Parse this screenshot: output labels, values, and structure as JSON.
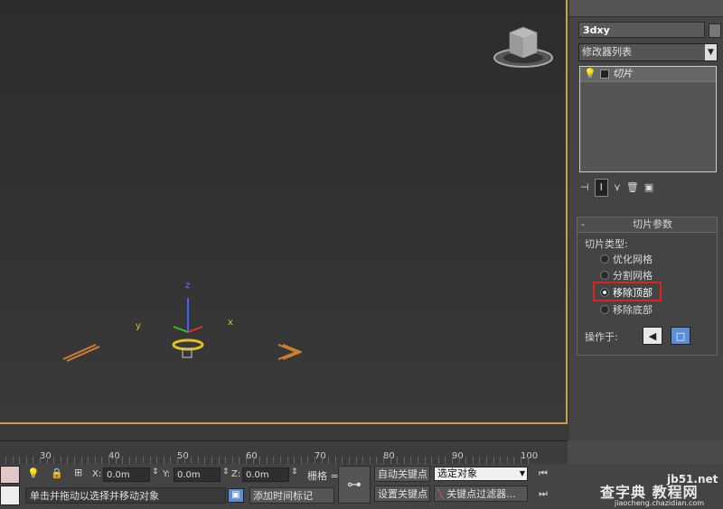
{
  "viewport": {
    "axis_labels": {
      "x": "x",
      "y": "y",
      "z": "z"
    }
  },
  "command_panel": {
    "object_name": "3dxy",
    "modifier_list": "修改器列表",
    "stack_item": "切片",
    "rollout_title": "切片参数",
    "slice_type_label": "切片类型:",
    "options": [
      "优化网格",
      "分割网格",
      "移除顶部",
      "移除底部"
    ],
    "selected_option": "移除顶部",
    "operate_on_label": "操作于:"
  },
  "timeline": {
    "ticks": [
      "30",
      "40",
      "50",
      "60",
      "70",
      "80",
      "90",
      "100"
    ]
  },
  "statusbar": {
    "x_label": "X:",
    "x_value": "0.0m",
    "y_label": "Y:",
    "y_value": "0.0m",
    "z_label": "Z:",
    "z_value": "0.0m",
    "grid_label": "栅格 =",
    "prompt": "单击并拖动以选择并移动对象",
    "add_time_tag": "添加时间标记",
    "auto_key": "自动关键点",
    "set_key": "设置关键点",
    "selected_object": "选定对象",
    "key_filters": "关键点过滤器..."
  },
  "watermark": {
    "site": "jb51.net",
    "text": "查字典 教程网",
    "url": "jiaocheng.chazidian.com"
  },
  "colors": {
    "accent_border": "#c9a14a",
    "highlight": "#dd2222",
    "active_button": "#5a8fd8"
  }
}
